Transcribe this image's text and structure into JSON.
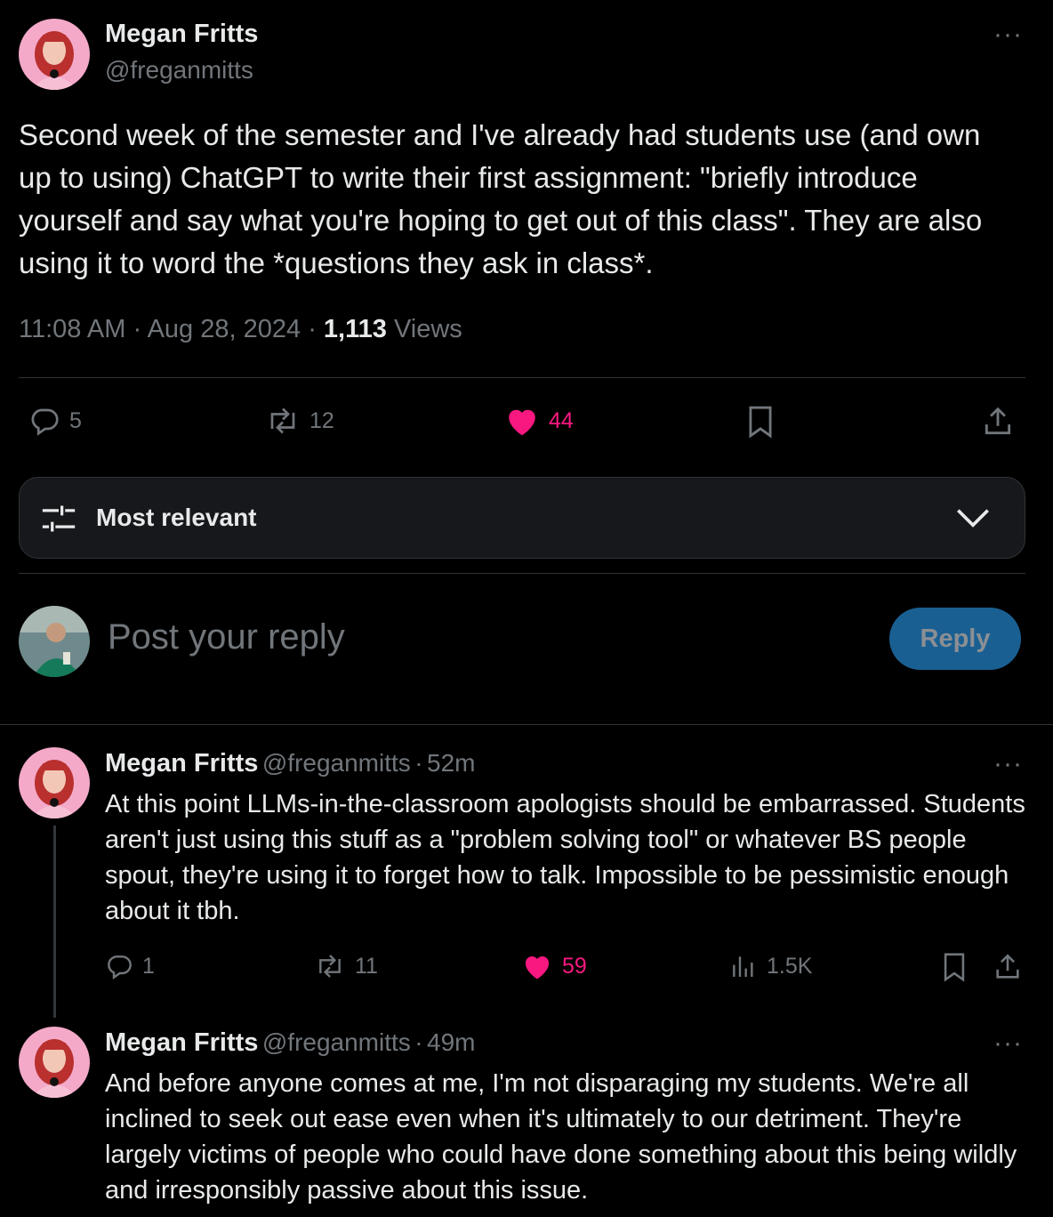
{
  "main_tweet": {
    "author_name": "Megan Fritts",
    "author_handle": "@freganmitts",
    "text": "Second week of the semester and I've already had students use (and own up to using) ChatGPT to write their first assignment: \"briefly introduce yourself and say what you're hoping to get out of this class\". They are also using it to word the *questions they ask in class*.",
    "time": "11:08 AM",
    "date": "Aug 28, 2024",
    "views_count": "1,113",
    "views_label": "Views",
    "replies": "5",
    "reposts": "12",
    "likes": "44"
  },
  "sort": {
    "label": "Most relevant"
  },
  "composer": {
    "placeholder": "Post your reply",
    "button_label": "Reply"
  },
  "replies": [
    {
      "author_name": "Megan Fritts",
      "author_handle": "@freganmitts",
      "time": "52m",
      "text": "At this point LLMs-in-the-classroom apologists should be embarrassed. Students aren't just using this stuff as a \"problem solving tool\" or whatever BS people spout, they're using it to forget how to talk. Impossible to be pessimistic enough about it tbh.",
      "replies": "1",
      "reposts": "11",
      "likes": "59",
      "views": "1.5K"
    },
    {
      "author_name": "Megan Fritts",
      "author_handle": "@freganmitts",
      "time": "49m",
      "text": "And before anyone comes at me, I'm not disparaging my students. We're all inclined to seek out ease even when it's ultimately to our detriment. They're largely victims of people who could have done something about this being wildly and irresponsibly passive about this issue."
    }
  ],
  "colors": {
    "like": "#f91880",
    "reply_button": "#1a5f92",
    "muted": "#71767b",
    "border": "#2f3336"
  }
}
